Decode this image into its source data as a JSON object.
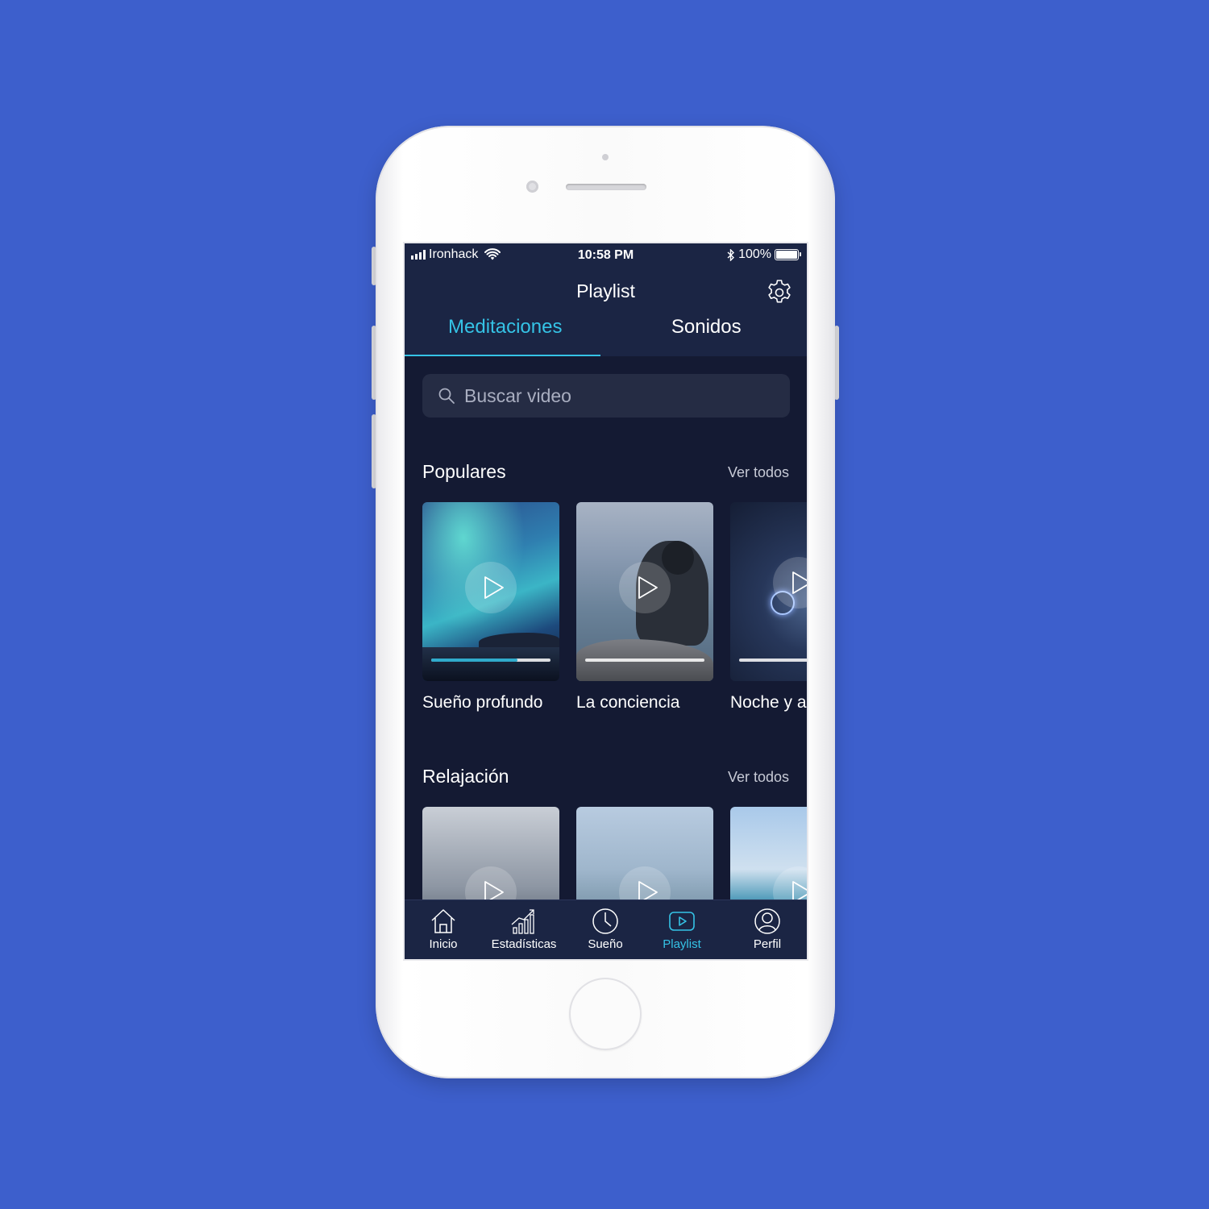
{
  "status_bar": {
    "carrier": "Ironhack",
    "time": "10:58 PM",
    "battery": "100%"
  },
  "header": {
    "title": "Playlist",
    "tabs": [
      {
        "label": "Meditaciones",
        "active": true
      },
      {
        "label": "Sonidos",
        "active": false
      }
    ]
  },
  "search": {
    "placeholder": "Buscar video"
  },
  "sections": [
    {
      "title": "Populares",
      "see_all": "Ver todos",
      "cards": [
        {
          "title": "Sueño profundo",
          "progress": 0.72
        },
        {
          "title": "La conciencia",
          "progress": 0.0
        },
        {
          "title": "Noche y a",
          "progress": 0.0
        }
      ]
    },
    {
      "title": "Relajación",
      "see_all": "Ver todos",
      "cards": [
        {
          "title": ""
        },
        {
          "title": ""
        },
        {
          "title": ""
        }
      ]
    }
  ],
  "tab_bar": [
    {
      "label": "Inicio",
      "icon": "home-icon",
      "active": false
    },
    {
      "label": "Estadísticas",
      "icon": "stats-icon",
      "active": false
    },
    {
      "label": "Sueño",
      "icon": "clock-icon",
      "active": false
    },
    {
      "label": "Playlist",
      "icon": "play-icon",
      "active": true
    },
    {
      "label": "Perfil",
      "icon": "profile-icon",
      "active": false
    }
  ],
  "colors": {
    "background": "#3d5fcc",
    "screen_bg": "#141a33",
    "header_bg": "#1b2544",
    "accent": "#35c3e6",
    "search_bg": "#252c44"
  }
}
